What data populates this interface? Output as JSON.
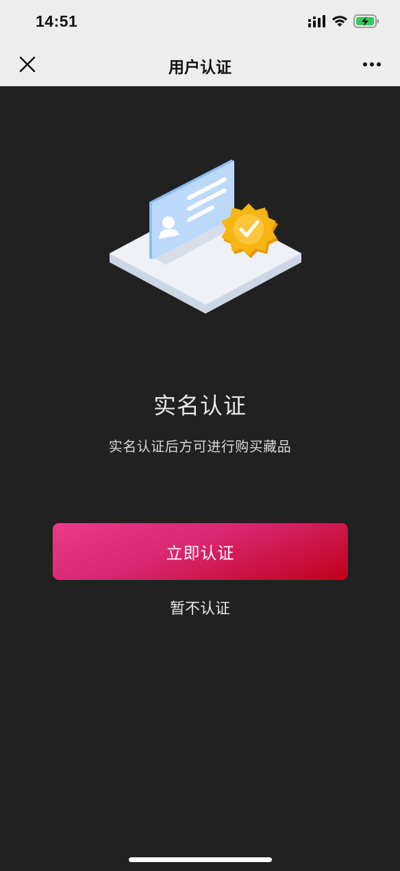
{
  "status_bar": {
    "time": "14:51",
    "icons": [
      "cellular-signal-icon",
      "wifi-icon",
      "battery-charging-icon"
    ]
  },
  "nav": {
    "title": "用户认证",
    "close_icon": "close-icon",
    "more_icon": "more-icon"
  },
  "content": {
    "illustration": "id-card-verified-illustration",
    "title": "实名认证",
    "description": "实名认证后方可进行购买藏品"
  },
  "actions": {
    "primary_label": "立即认证",
    "secondary_label": "暂不认证"
  },
  "colors": {
    "background": "#212121",
    "nav_background": "#ededed",
    "button_gradient_start": "#ec3a8a",
    "button_gradient_end": "#c0001a",
    "badge": "#f5b400"
  }
}
